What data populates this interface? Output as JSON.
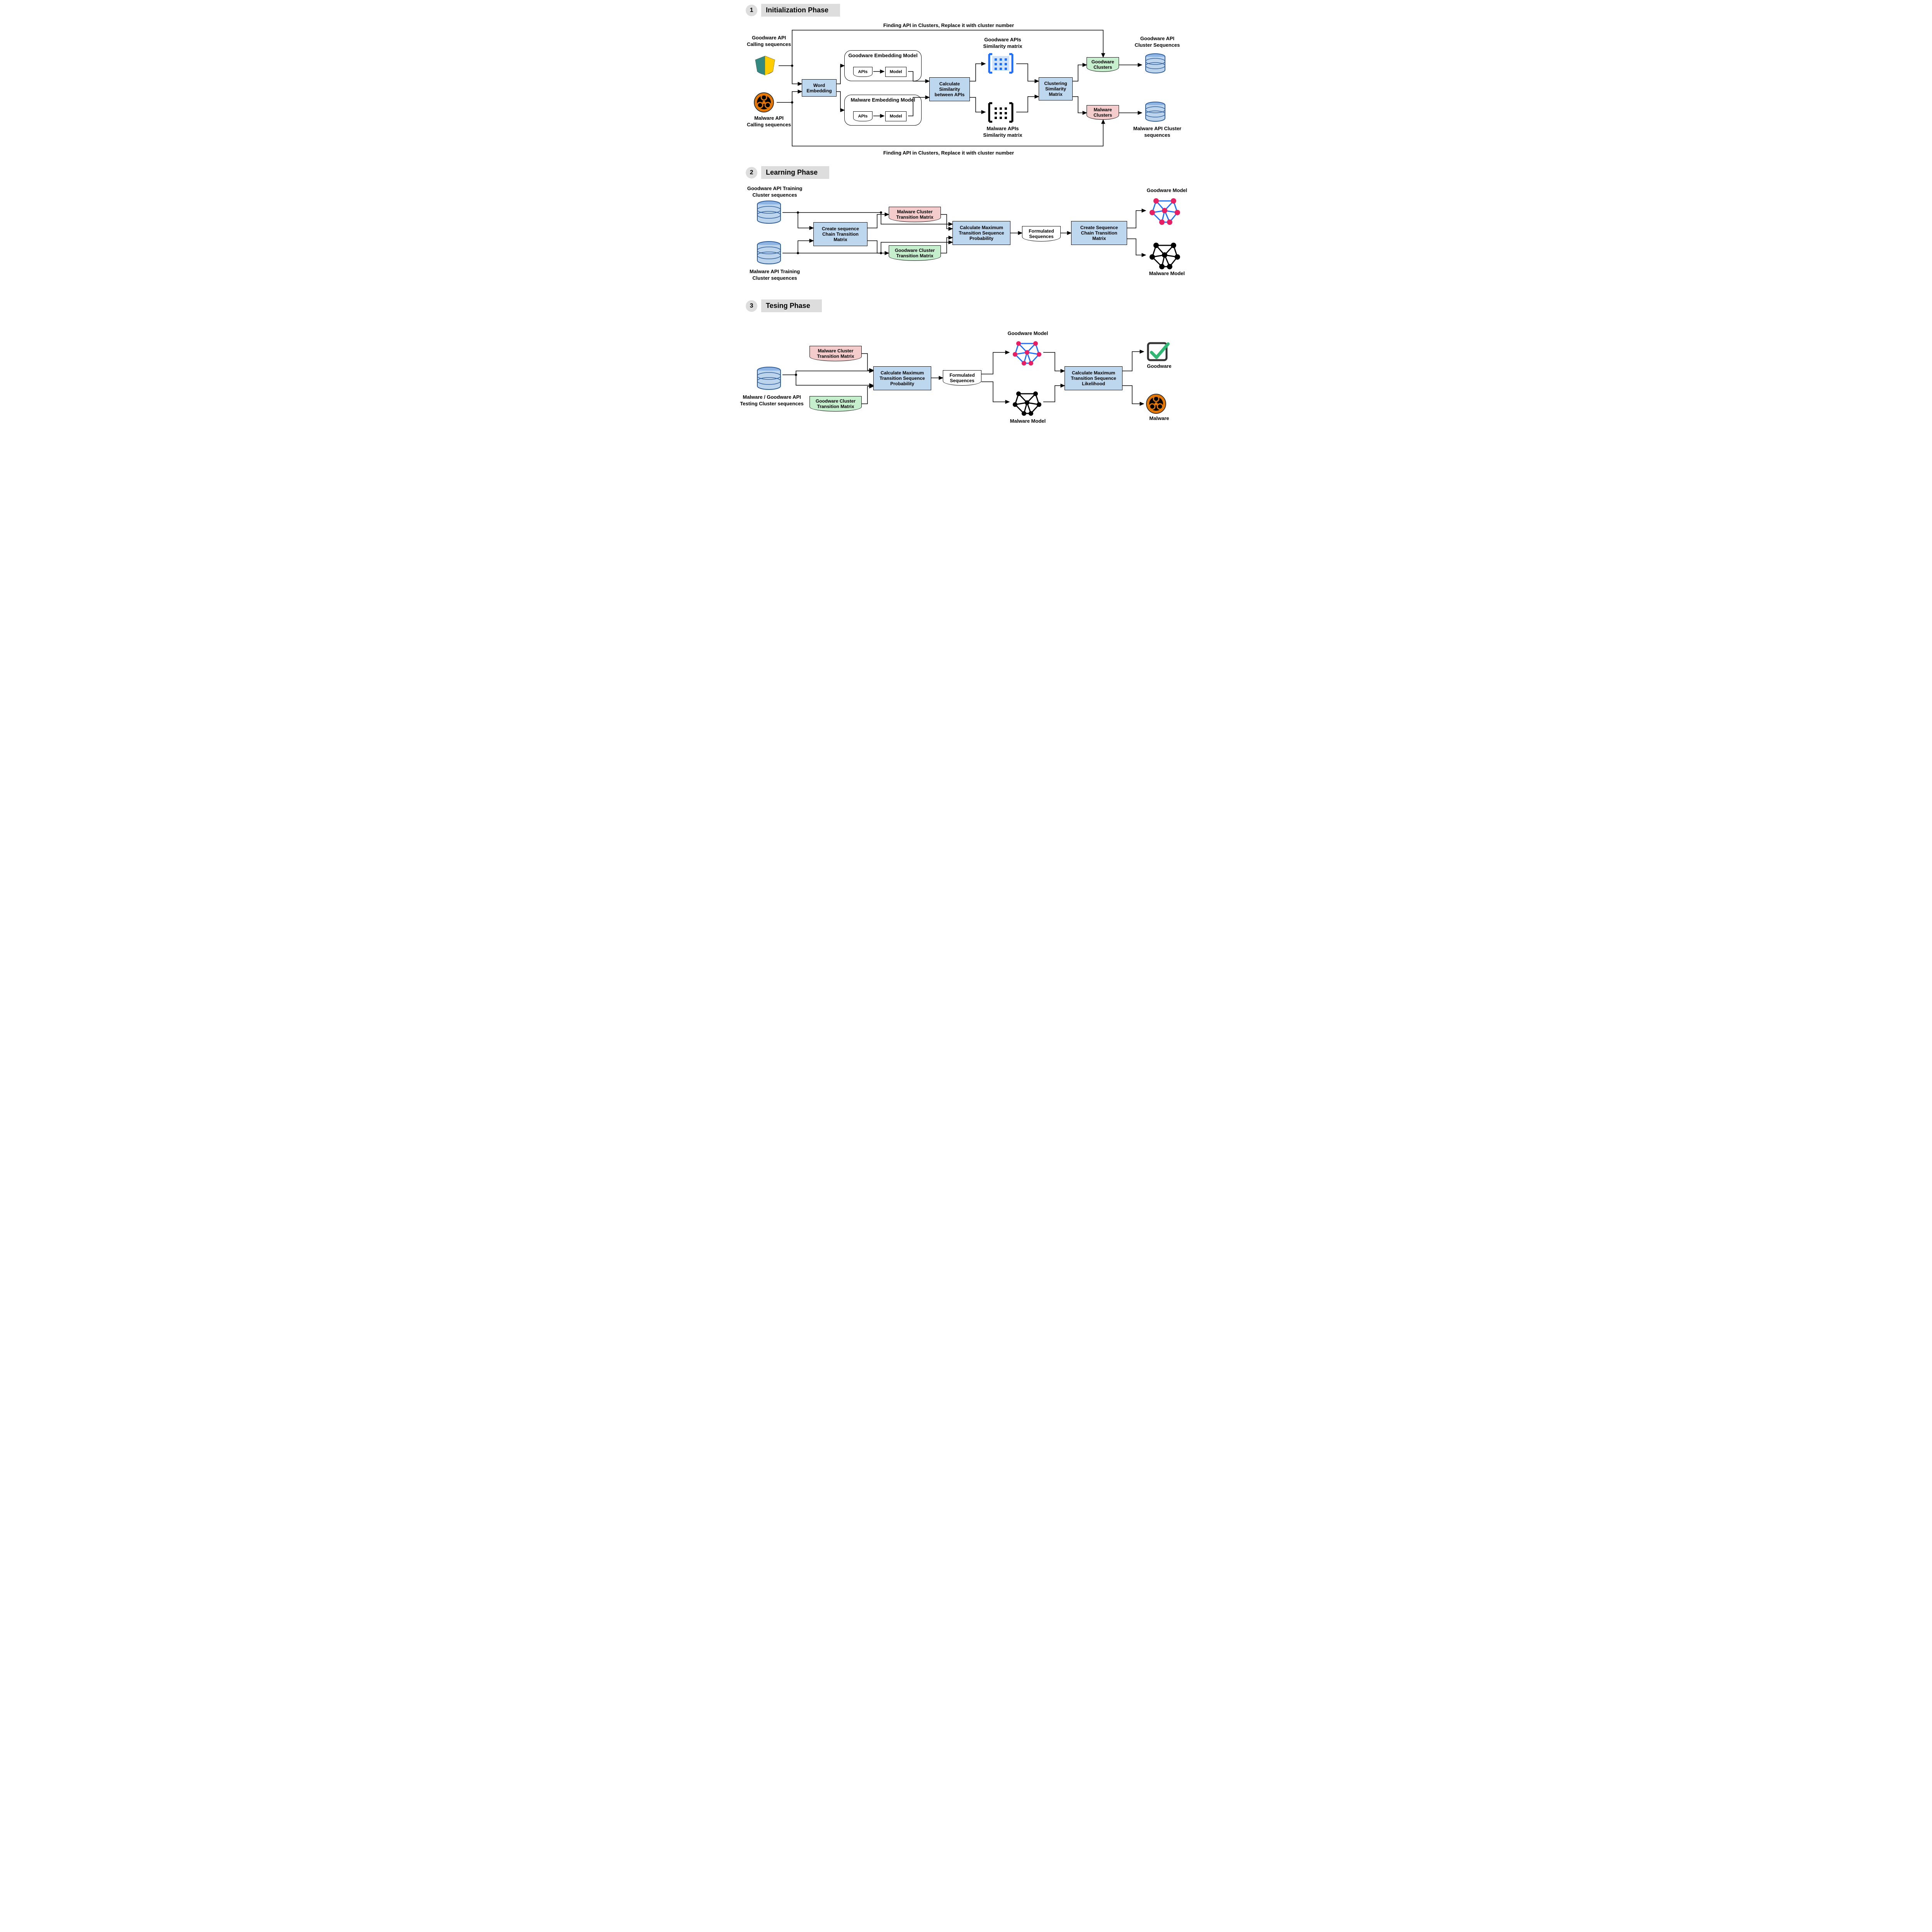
{
  "phases": {
    "p1": {
      "num": "1",
      "title": "Initialization Phase"
    },
    "p2": {
      "num": "2",
      "title": "Learning Phase"
    },
    "p3": {
      "num": "3",
      "title": "Tesing Phase"
    }
  },
  "phase1": {
    "note_top": "Finding API in Clusters, Replace it with cluster number",
    "note_bottom": "Finding API in Clusters, Replace it with cluster number",
    "goodware_api_calling": "Goodware API Calling sequences",
    "malware_api_calling": "Malware API Calling sequences",
    "word_embedding": "Word Embedding",
    "goodware_embed_model": "Goodware Embedding Model",
    "malware_embed_model": "Malware Embedding Model",
    "apis": "APIs",
    "model": "Model",
    "calc_sim": "Calculate Similarity between APIs",
    "goodware_sim_matrix": "Goodware APIs Similarity matrix",
    "malware_sim_matrix": "Malware APIs Similarity matrix",
    "clustering": "Clustering Similarity Matrix",
    "goodware_clusters": "Goodware Clusters",
    "malware_clusters": "Malware Clusters",
    "goodware_api_cluster_seq": "Goodware API Cluster Sequences",
    "malware_api_cluster_seq": "Malware API Cluster sequences"
  },
  "phase2": {
    "goodware_training": "Goodware API Training Cluster sequences",
    "malware_training": "Malware API Training Cluster sequences",
    "create_chain": "Create sequence Chain Transition Matrix",
    "malware_cluster_tm": "Malware Cluster Transition Matrix",
    "goodware_cluster_tm": "Goodware Cluster Transition Matrix",
    "calc_max": "Calculate Maximum Transition Sequence Probability",
    "formulated": "Formulated Sequences",
    "create_seq_chain": "Create Sequence Chain Transition Matrix",
    "goodware_model": "Goodware Model",
    "malware_model": "Malware Model"
  },
  "phase3": {
    "testing_input": "Malware / Goodware API Testing Cluster sequences",
    "malware_cluster_tm": "Malware Cluster Transition Matrix",
    "goodware_cluster_tm": "Goodware Cluster Transition Matrix",
    "calc_max": "Calculate Maximum Transition Sequence Probability",
    "formulated": "Formulated Sequences",
    "goodware_model": "Goodware Model",
    "malware_model": "Malware Model",
    "calc_likelihood": "Calculate Maximum Transition Sequence Likelihood",
    "goodware": "Goodware",
    "malware": "Malware"
  }
}
